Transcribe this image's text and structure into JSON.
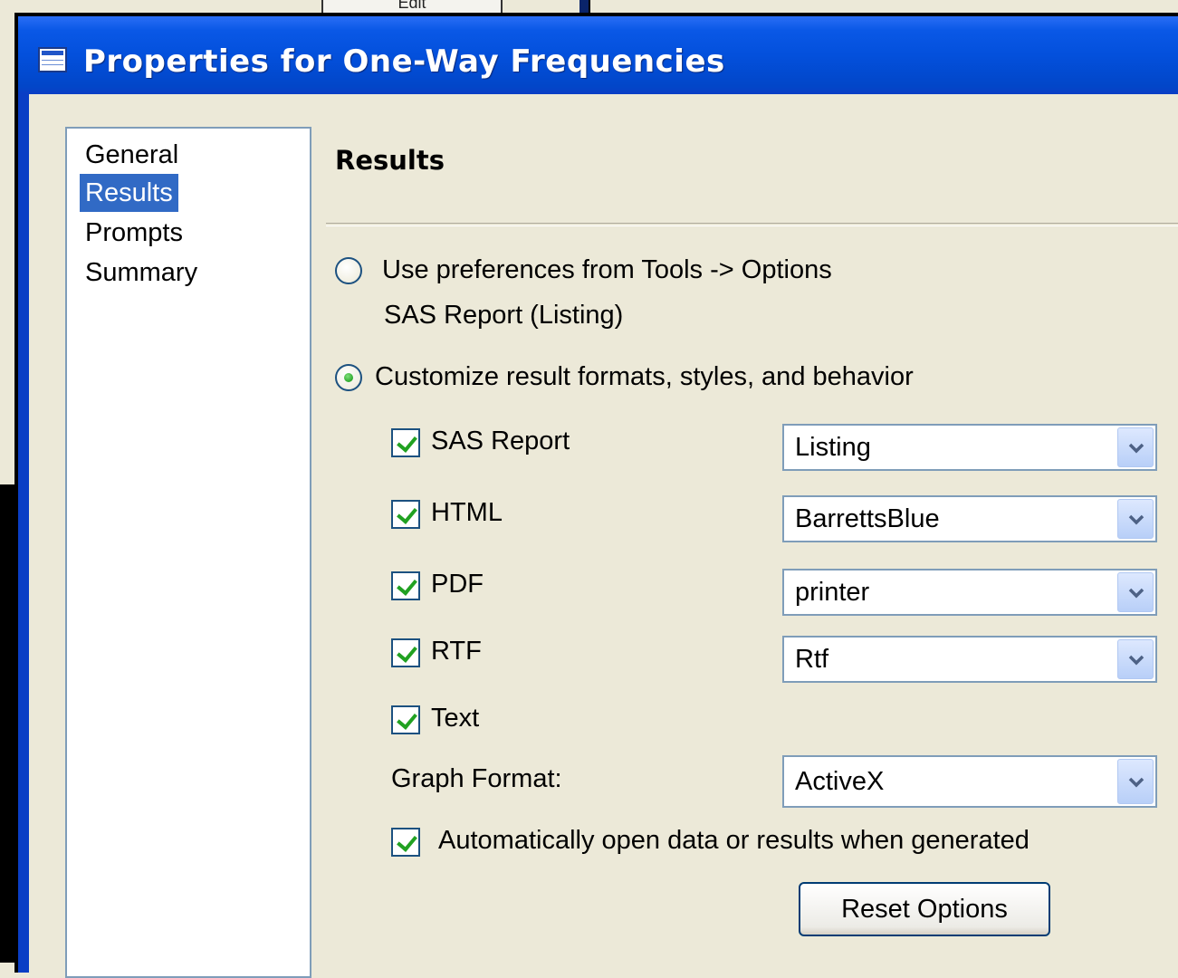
{
  "background_window": {
    "edit_label": "Edit"
  },
  "dialog": {
    "title": "Properties for One-Way Frequencies",
    "nav_items": [
      "General",
      "Results",
      "Prompts",
      "Summary"
    ],
    "selected_nav": "Results",
    "section_title": "Results",
    "radio_prefs": {
      "label": "Use preferences from Tools -> Options",
      "sublabel": "SAS Report (Listing)",
      "checked": false
    },
    "radio_custom": {
      "label": "Customize result formats, styles, and behavior",
      "checked": true
    },
    "formats": [
      {
        "label": "SAS Report",
        "checked": true,
        "style": "Listing"
      },
      {
        "label": "HTML",
        "checked": true,
        "style": "BarrettsBlue"
      },
      {
        "label": "PDF",
        "checked": true,
        "style": "printer"
      },
      {
        "label": "RTF",
        "checked": true,
        "style": "Rtf"
      },
      {
        "label": "Text",
        "checked": true
      }
    ],
    "graph_format": {
      "label": "Graph Format:",
      "value": "ActiveX"
    },
    "auto_open": {
      "label": "Automatically open data or results when generated",
      "checked": true
    },
    "reset_button": "Reset Options"
  },
  "colors": {
    "titlebar": "#0350dc",
    "dialog_bg": "#ece9d8",
    "selection": "#316ac5",
    "check_green": "#21a121"
  }
}
